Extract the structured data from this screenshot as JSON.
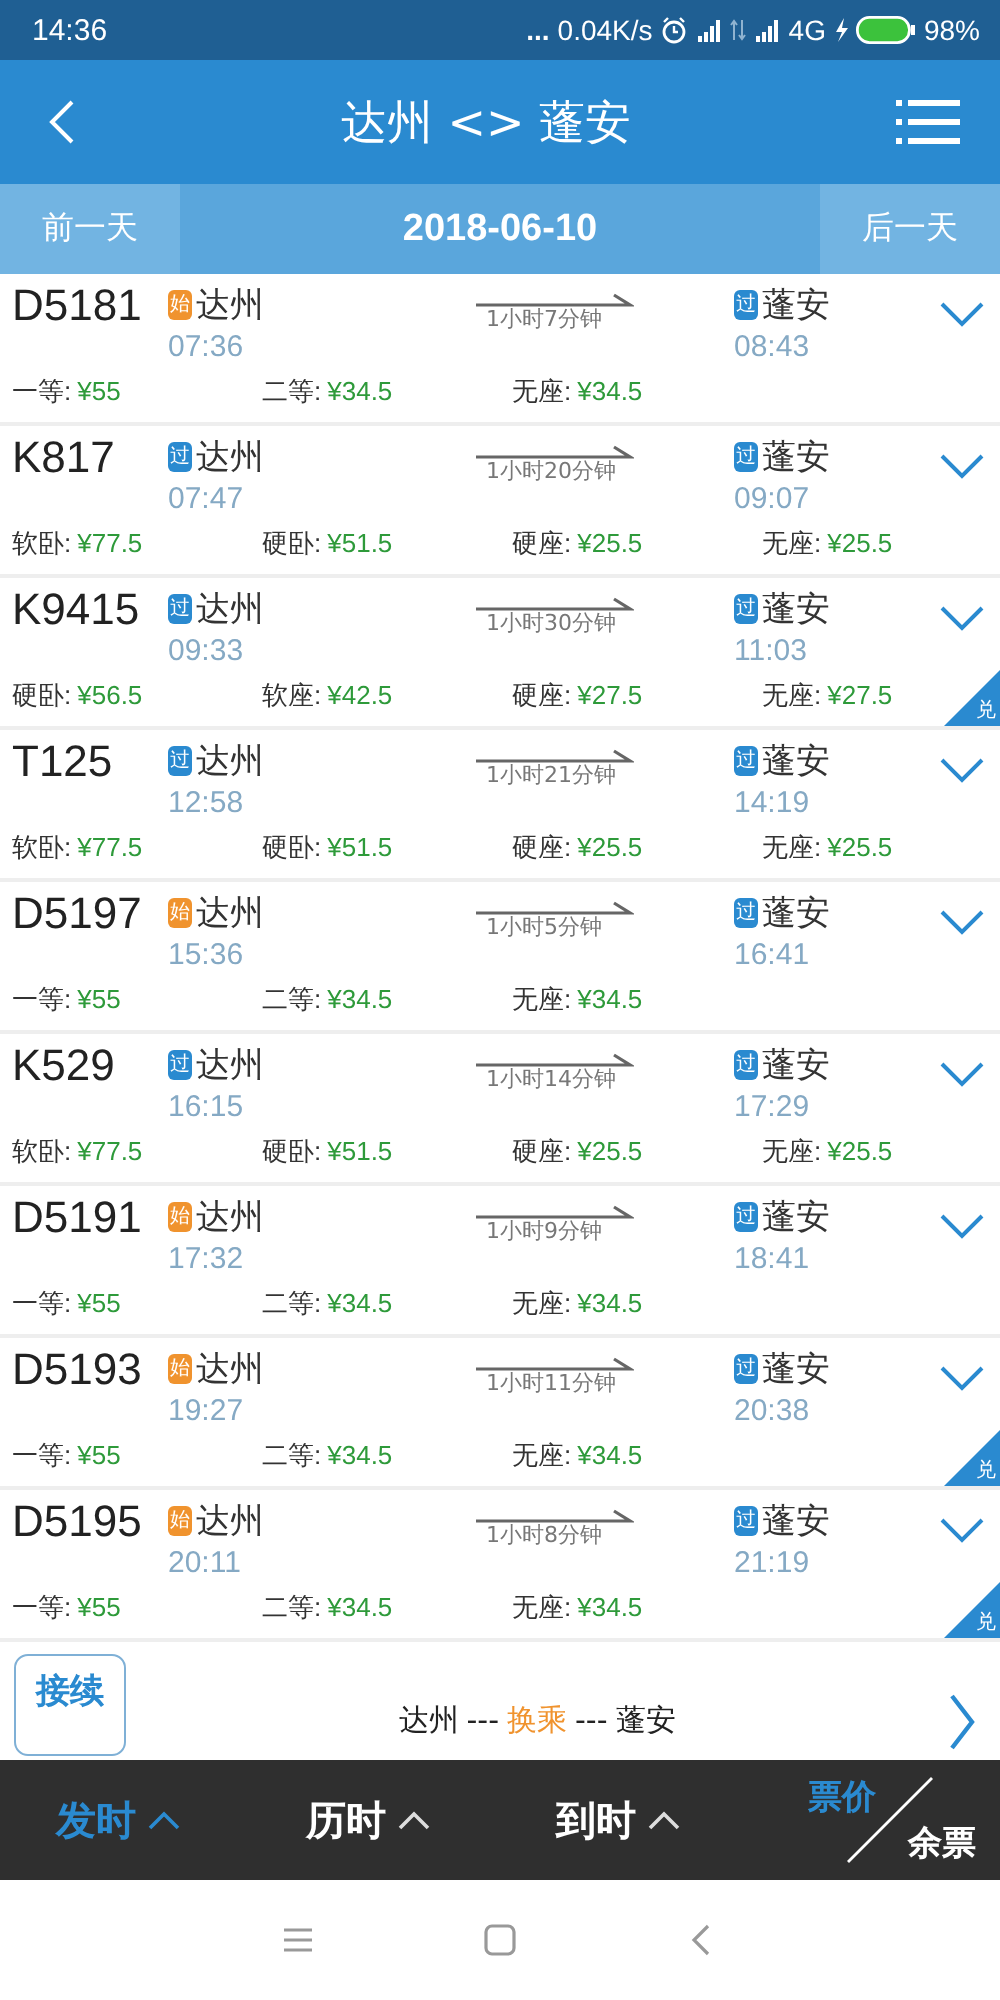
{
  "status_bar": {
    "time": "14:36",
    "dots": "...",
    "speed": "0.04K/s",
    "network": "4G",
    "battery": "98%"
  },
  "header": {
    "title": "达州 <> 蓬安"
  },
  "date_bar": {
    "prev": "前一天",
    "date": "2018-06-10",
    "next": "后一天"
  },
  "trains": [
    {
      "number": "D5181",
      "from": {
        "tag": "始",
        "kind": "start",
        "name": "达州",
        "time": "07:36"
      },
      "duration": "1小时7分钟",
      "to": {
        "tag": "过",
        "kind": "pass",
        "name": "蓬安",
        "time": "08:43"
      },
      "prices": [
        {
          "label": "一等:",
          "price": "¥55"
        },
        {
          "label": "二等:",
          "price": "¥34.5"
        },
        {
          "label": "无座:",
          "price": "¥34.5"
        }
      ]
    },
    {
      "number": "K817",
      "from": {
        "tag": "过",
        "kind": "pass",
        "name": "达州",
        "time": "07:47"
      },
      "duration": "1小时20分钟",
      "to": {
        "tag": "过",
        "kind": "pass",
        "name": "蓬安",
        "time": "09:07"
      },
      "prices": [
        {
          "label": "软卧:",
          "price": "¥77.5"
        },
        {
          "label": "硬卧:",
          "price": "¥51.5"
        },
        {
          "label": "硬座:",
          "price": "¥25.5"
        },
        {
          "label": "无座:",
          "price": "¥25.5"
        }
      ]
    },
    {
      "number": "K9415",
      "from": {
        "tag": "过",
        "kind": "pass",
        "name": "达州",
        "time": "09:33"
      },
      "duration": "1小时30分钟",
      "to": {
        "tag": "过",
        "kind": "pass",
        "name": "蓬安",
        "time": "11:03"
      },
      "redeem": "兑",
      "prices": [
        {
          "label": "硬卧:",
          "price": "¥56.5"
        },
        {
          "label": "软座:",
          "price": "¥42.5"
        },
        {
          "label": "硬座:",
          "price": "¥27.5"
        },
        {
          "label": "无座:",
          "price": "¥27.5"
        }
      ]
    },
    {
      "number": "T125",
      "from": {
        "tag": "过",
        "kind": "pass",
        "name": "达州",
        "time": "12:58"
      },
      "duration": "1小时21分钟",
      "to": {
        "tag": "过",
        "kind": "pass",
        "name": "蓬安",
        "time": "14:19"
      },
      "prices": [
        {
          "label": "软卧:",
          "price": "¥77.5"
        },
        {
          "label": "硬卧:",
          "price": "¥51.5"
        },
        {
          "label": "硬座:",
          "price": "¥25.5"
        },
        {
          "label": "无座:",
          "price": "¥25.5"
        }
      ]
    },
    {
      "number": "D5197",
      "from": {
        "tag": "始",
        "kind": "start",
        "name": "达州",
        "time": "15:36"
      },
      "duration": "1小时5分钟",
      "to": {
        "tag": "过",
        "kind": "pass",
        "name": "蓬安",
        "time": "16:41"
      },
      "prices": [
        {
          "label": "一等:",
          "price": "¥55"
        },
        {
          "label": "二等:",
          "price": "¥34.5"
        },
        {
          "label": "无座:",
          "price": "¥34.5"
        }
      ]
    },
    {
      "number": "K529",
      "from": {
        "tag": "过",
        "kind": "pass",
        "name": "达州",
        "time": "16:15"
      },
      "duration": "1小时14分钟",
      "to": {
        "tag": "过",
        "kind": "pass",
        "name": "蓬安",
        "time": "17:29"
      },
      "prices": [
        {
          "label": "软卧:",
          "price": "¥77.5"
        },
        {
          "label": "硬卧:",
          "price": "¥51.5"
        },
        {
          "label": "硬座:",
          "price": "¥25.5"
        },
        {
          "label": "无座:",
          "price": "¥25.5"
        }
      ]
    },
    {
      "number": "D5191",
      "from": {
        "tag": "始",
        "kind": "start",
        "name": "达州",
        "time": "17:32"
      },
      "duration": "1小时9分钟",
      "to": {
        "tag": "过",
        "kind": "pass",
        "name": "蓬安",
        "time": "18:41"
      },
      "prices": [
        {
          "label": "一等:",
          "price": "¥55"
        },
        {
          "label": "二等:",
          "price": "¥34.5"
        },
        {
          "label": "无座:",
          "price": "¥34.5"
        }
      ]
    },
    {
      "number": "D5193",
      "from": {
        "tag": "始",
        "kind": "start",
        "name": "达州",
        "time": "19:27"
      },
      "duration": "1小时11分钟",
      "to": {
        "tag": "过",
        "kind": "pass",
        "name": "蓬安",
        "time": "20:38"
      },
      "redeem": "兑",
      "prices": [
        {
          "label": "一等:",
          "price": "¥55"
        },
        {
          "label": "二等:",
          "price": "¥34.5"
        },
        {
          "label": "无座:",
          "price": "¥34.5"
        }
      ]
    },
    {
      "number": "D5195",
      "from": {
        "tag": "始",
        "kind": "start",
        "name": "达州",
        "time": "20:11"
      },
      "duration": "1小时8分钟",
      "to": {
        "tag": "过",
        "kind": "pass",
        "name": "蓬安",
        "time": "21:19"
      },
      "redeem": "兑",
      "prices": [
        {
          "label": "一等:",
          "price": "¥55"
        },
        {
          "label": "二等:",
          "price": "¥34.5"
        },
        {
          "label": "无座:",
          "price": "¥34.5"
        }
      ]
    }
  ],
  "transfer": {
    "button": "接续",
    "from": "达州",
    "sep1": "---",
    "middle": "换乘",
    "sep2": "---",
    "to": "蓬安"
  },
  "sort_bar": {
    "items": [
      {
        "label": "发时",
        "selected": true
      },
      {
        "label": "历时",
        "selected": false
      },
      {
        "label": "到时",
        "selected": false
      }
    ],
    "toggle": [
      {
        "label": "票价",
        "selected": true
      },
      {
        "label": "余票",
        "selected": false
      }
    ]
  }
}
